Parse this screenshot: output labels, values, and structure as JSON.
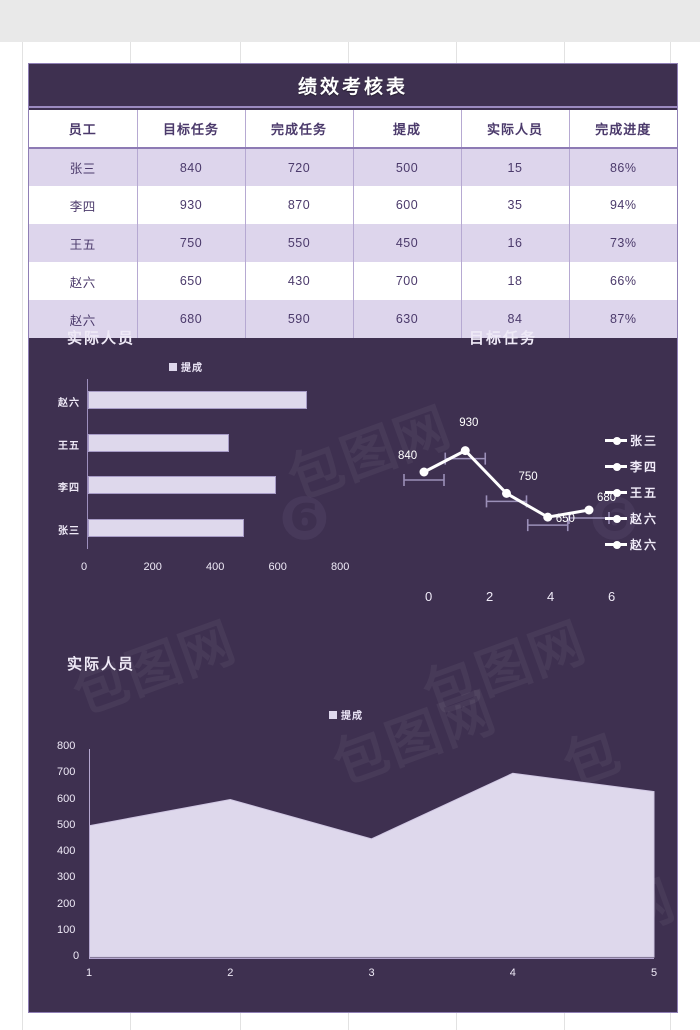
{
  "document": {
    "title": "绩效考核表",
    "watermark": "包图网"
  },
  "theme": {
    "panel_bg": "#3e3050",
    "panel_border": "#8f7fb5",
    "row_stripe": "#ddd5ec",
    "row_plain": "#ffffff",
    "text_purple": "#4b3a6b",
    "series_fill": "#ded8ec",
    "accent_green": "#2fa82f"
  },
  "table": {
    "headers": [
      "员工",
      "目标任务",
      "完成任务",
      "提成",
      "实际人员",
      "完成进度"
    ],
    "rows": [
      {
        "employee": "张三",
        "target": "840",
        "completed": "720",
        "commission": "500",
        "actual_staff": "15",
        "progress": "86%"
      },
      {
        "employee": "李四",
        "target": "930",
        "completed": "870",
        "commission": "600",
        "actual_staff": "35",
        "progress": "94%"
      },
      {
        "employee": "王五",
        "target": "750",
        "completed": "550",
        "commission": "450",
        "actual_staff": "16",
        "progress": "73%"
      },
      {
        "employee": "赵六",
        "target": "650",
        "completed": "430",
        "commission": "700",
        "actual_staff": "18",
        "progress": "66%"
      },
      {
        "employee": "赵六",
        "target": "680",
        "completed": "590",
        "commission": "630",
        "actual_staff": "84",
        "progress": "87%"
      }
    ]
  },
  "chart_data": [
    {
      "id": "bar",
      "type": "bar",
      "orientation": "horizontal",
      "title": "实际人员",
      "legend": [
        "提成"
      ],
      "legend_position": "top",
      "categories": [
        "张三",
        "李四",
        "王五",
        "赵六"
      ],
      "values": [
        500,
        600,
        450,
        700
      ],
      "xlabel": "",
      "ylabel": "",
      "xlim": [
        0,
        800
      ],
      "xticks": [
        "0",
        "200",
        "400",
        "600",
        "800"
      ],
      "grid": false
    },
    {
      "id": "line",
      "type": "line",
      "title": "目标任务",
      "legend": [
        "张三",
        "李四",
        "王五",
        "赵六",
        "赵六"
      ],
      "legend_position": "right",
      "x": [
        1,
        2,
        3,
        4,
        5
      ],
      "values": [
        840,
        930,
        750,
        650,
        680
      ],
      "data_labels": [
        "840",
        "930",
        "750",
        "650",
        "680"
      ],
      "xlabel": "",
      "ylabel": "",
      "xlim": [
        0,
        6
      ],
      "xticks": [
        "0",
        "2",
        "4",
        "6"
      ],
      "error_bars": true,
      "grid": false
    },
    {
      "id": "area",
      "type": "area",
      "title": "实际人员",
      "legend": [
        "提成"
      ],
      "legend_position": "top",
      "categories": [
        "1",
        "2",
        "3",
        "4",
        "5"
      ],
      "values": [
        500,
        600,
        450,
        700,
        630
      ],
      "xlabel": "",
      "ylabel": "",
      "ylim": [
        0,
        800
      ],
      "yticks": [
        "800",
        "700",
        "600",
        "500",
        "400",
        "300",
        "200",
        "100",
        "0"
      ],
      "xticks": [
        "1",
        "2",
        "3",
        "4",
        "5"
      ],
      "grid": false
    }
  ]
}
